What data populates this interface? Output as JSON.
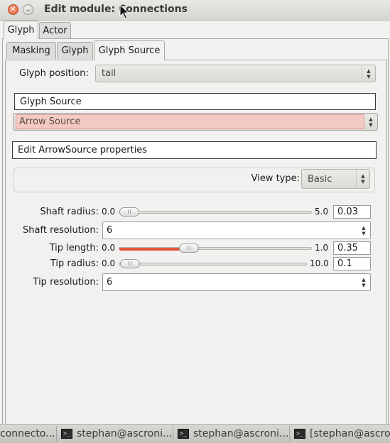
{
  "window": {
    "title": "Edit module: Connections"
  },
  "outer_tabs": [
    {
      "label": "Glyph",
      "active": true
    },
    {
      "label": "Actor",
      "active": false
    }
  ],
  "inner_tabs": [
    {
      "label": "Masking",
      "active": false
    },
    {
      "label": "Glyph",
      "active": false
    },
    {
      "label": "Glyph Source",
      "active": true
    }
  ],
  "glyph_position": {
    "label": "Glyph position:",
    "value": "tail"
  },
  "glyph_source": {
    "header": "Glyph Source",
    "value": "Arrow Source"
  },
  "props_header": "Edit ArrowSource properties",
  "view_type": {
    "label": "View type:",
    "value": "Basic"
  },
  "params": {
    "shaft_radius": {
      "label": "Shaft radius:",
      "min": "0.0",
      "max": "5.0",
      "value": "0.03",
      "fraction": 0.006
    },
    "shaft_resolution": {
      "label": "Shaft resolution:",
      "value": "6"
    },
    "tip_length": {
      "label": "Tip length:",
      "min": "0.0",
      "max": "1.0",
      "value": "0.35",
      "fraction": 0.35
    },
    "tip_radius": {
      "label": "Tip radius:",
      "min": "0.0",
      "max": "10.0",
      "value": "0.1",
      "fraction": 0.01
    },
    "tip_resolution": {
      "label": "Tip resolution:",
      "value": "6"
    }
  },
  "taskbar": [
    {
      "label": "connecto...",
      "icon": ""
    },
    {
      "label": "stephan@ascroni...",
      "icon": "terminal-icon"
    },
    {
      "label": "stephan@ascroni...",
      "icon": "terminal-icon"
    },
    {
      "label": "[stephan@ascron",
      "icon": "terminal-icon"
    }
  ],
  "colors": {
    "accent": "#e2573a",
    "combo_highlight": "#f3c9c3",
    "close_button": "#e05a35"
  }
}
